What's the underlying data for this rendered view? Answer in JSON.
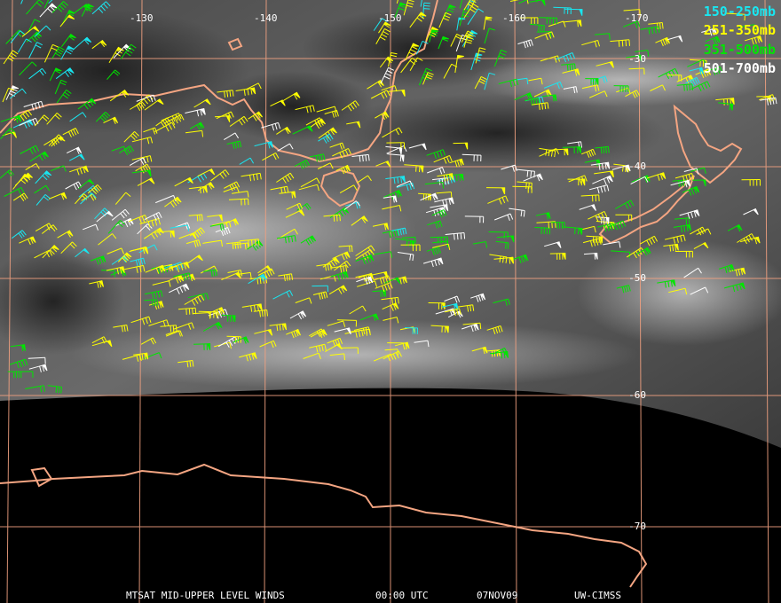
{
  "map": {
    "lon_labels": [
      "-130",
      "-140",
      "-150",
      "-160",
      "-170"
    ],
    "lat_labels": [
      "-30",
      "-40",
      "-50",
      "-60",
      "-70"
    ],
    "gridline_color": "#f0a080",
    "coastline_color": "#f4a582",
    "earth_disk_edge": "curved"
  },
  "legend": [
    {
      "label": "150-250mb",
      "color": "#19e6f0"
    },
    {
      "label": "251-350mb",
      "color": "#ffff00"
    },
    {
      "label": "351-500mb",
      "color": "#00e600"
    },
    {
      "label": "501-700mb",
      "color": "#ffffff"
    }
  ],
  "caption": {
    "product": "MTSAT MID-UPPER LEVEL WINDS",
    "time": "00:00 UTC",
    "date": "07NOV09",
    "source": "UW-CIMSS"
  }
}
